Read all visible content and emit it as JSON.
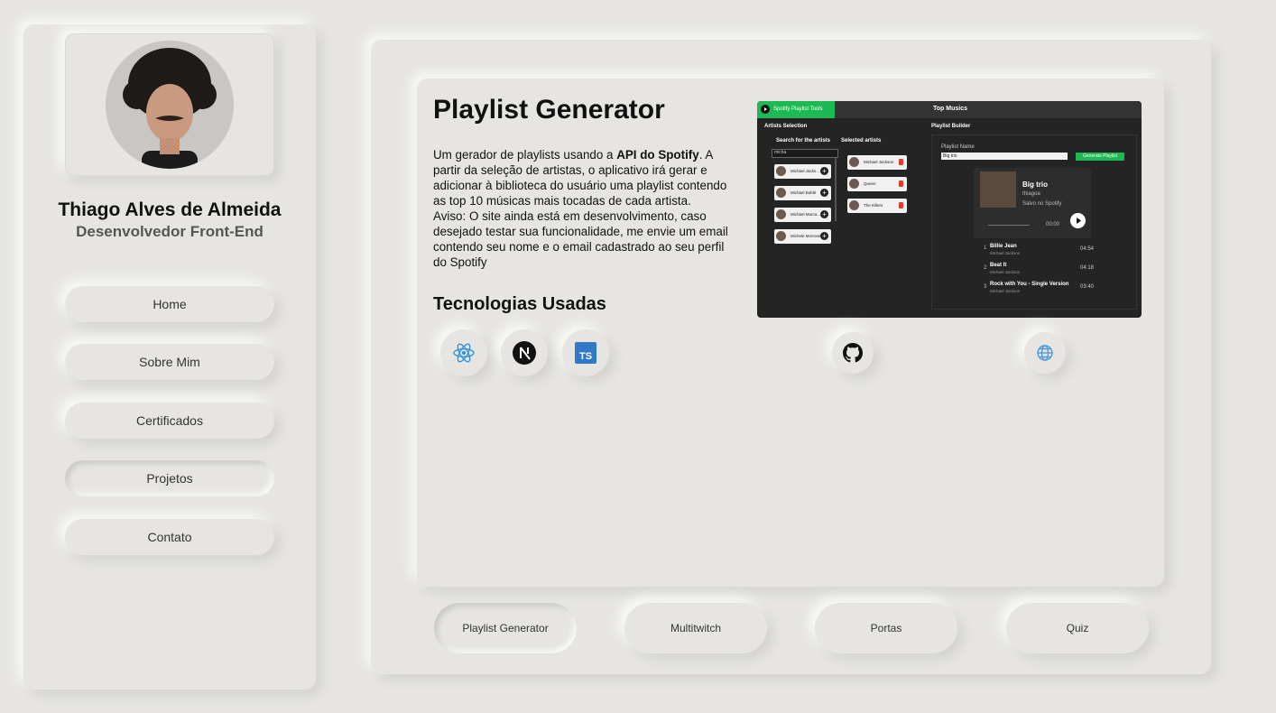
{
  "profile": {
    "name": "Thiago Alves de Almeida",
    "role": "Desenvolvedor Front-End"
  },
  "nav": {
    "items": [
      {
        "label": "Home",
        "active": false
      },
      {
        "label": "Sobre Mim",
        "active": false
      },
      {
        "label": "Certificados",
        "active": false
      },
      {
        "label": "Projetos",
        "active": true
      },
      {
        "label": "Contato",
        "active": false
      }
    ]
  },
  "project": {
    "title": "Playlist Generator",
    "desc_1": "Um gerador de playlists usando a ",
    "desc_bold": "API do Spotify",
    "desc_2": ". A partir da seleção de artistas, o aplicativo irá gerar e adicionar à biblioteca do usuário uma playlist contendo as top 10 músicas mais tocadas de cada artista.",
    "warning": "Aviso: O site ainda está em desenvolvimento, caso desejado testar sua funcionalidade, me envie um email contendo seu nome e o email cadastrado ao seu perfil do Spotify",
    "tech_title": "Tecnologias Usadas",
    "technologies": [
      {
        "name": "React",
        "icon": "react-icon",
        "color": "#2f8fd8"
      },
      {
        "name": "Next.js",
        "icon": "nextjs-icon",
        "color": "#111111"
      },
      {
        "name": "TypeScript",
        "icon": "typescript-icon",
        "color": "#3178c6"
      }
    ],
    "links": [
      {
        "icon": "github-icon"
      },
      {
        "icon": "globe-icon",
        "color": "#4f9bd8"
      }
    ]
  },
  "preview": {
    "brand": "Spotify Playlist Tools",
    "header": "Top Musics",
    "artists_section": "Artists Selection",
    "search_label": "Search for the artists",
    "search_value": "micha",
    "selected_label": "Selected artists",
    "search_results": [
      "Michael Jacks...",
      "Michael Bublé",
      "Michael Marca...",
      "Michele Morrone"
    ],
    "selected_artists": [
      "Michael Jackson",
      "Queen",
      "The Killers"
    ],
    "builder_label": "Playlist Builder",
    "playlist_name_label": "Playlist Name",
    "playlist_name_value": "Big trio",
    "generate_label": "Generate Playlist",
    "playlist": {
      "title": "Big trio",
      "owner": "thiagoa",
      "saved": "Salvo no Spotify",
      "time": "00:00",
      "tracks": [
        {
          "n": "1",
          "title": "Billie Jean",
          "artist": "Michael Jackson",
          "duration": "04:54"
        },
        {
          "n": "2",
          "title": "Beat It",
          "artist": "Michael Jackson",
          "duration": "04:18"
        },
        {
          "n": "3",
          "title": "Rock with You - Single Version",
          "artist": "Michael Jackson",
          "duration": "03:40"
        }
      ]
    },
    "accent": "#1db954"
  },
  "tabs": [
    {
      "label": "Playlist Generator",
      "active": true
    },
    {
      "label": "Multitwitch",
      "active": false
    },
    {
      "label": "Portas",
      "active": false
    },
    {
      "label": "Quiz",
      "active": false
    }
  ]
}
